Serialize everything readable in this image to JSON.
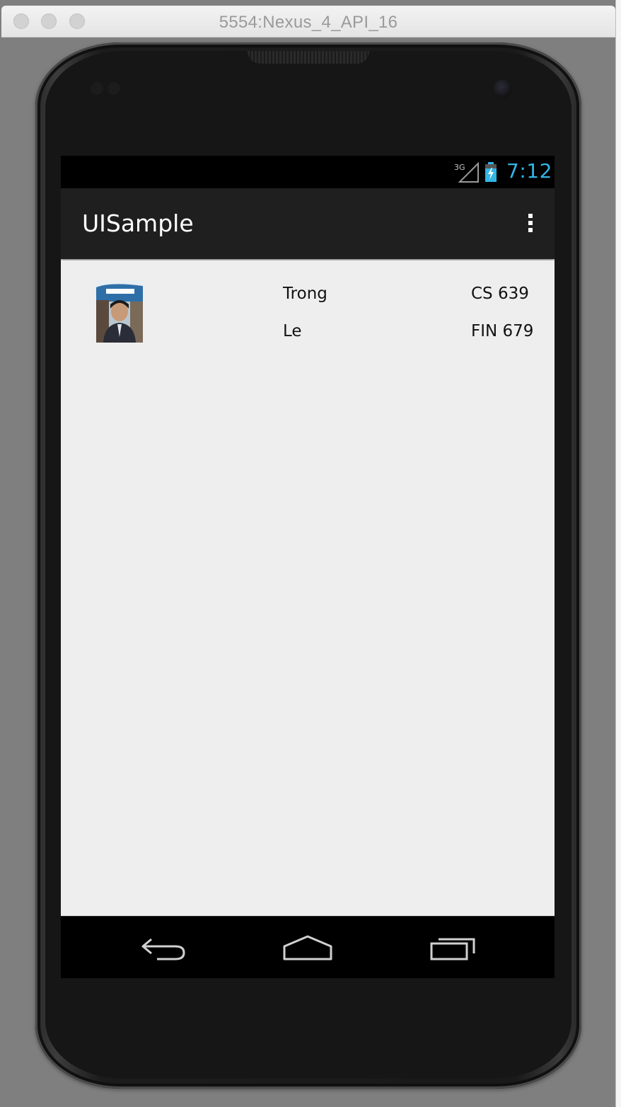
{
  "window": {
    "title": "5554:Nexus_4_API_16"
  },
  "statusbar": {
    "network": "3G",
    "time": "7:12",
    "accent_color": "#33b5e5"
  },
  "actionbar": {
    "title": "UISample",
    "overflow_icon": "overflow-menu-icon"
  },
  "list": {
    "items": [
      {
        "avatar": "profile-photo",
        "first_name": "Trong",
        "last_name": "Le",
        "course_1": "CS 639",
        "course_2": "FIN 679"
      }
    ]
  },
  "navbar": {
    "back_icon": "back-icon",
    "home_icon": "home-icon",
    "recents_icon": "recents-icon"
  }
}
